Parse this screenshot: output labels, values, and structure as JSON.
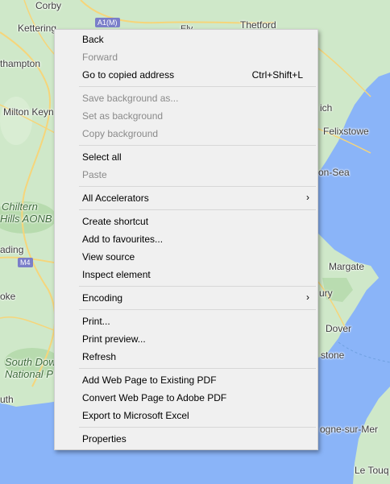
{
  "map": {
    "labels": {
      "corby": "Corby",
      "kettering": "Kettering",
      "a1m": "A1(M)",
      "ely": "Ely",
      "thetford": "Thetford",
      "hampton": "thampton",
      "milton_keynes": "Milton Keyn",
      "ich": "ich",
      "felixstowe": "Felixstowe",
      "on_sea": "on-Sea",
      "chiltern": "Chiltern",
      "hills_aonb": "Hills AONB",
      "ading": "ading",
      "m4": "M4",
      "margate": "Margate",
      "oke": "oke",
      "ury": "ury",
      "dover": "Dover",
      "stone": "stone",
      "south_downs": "South Dow",
      "national_p": "National P",
      "uth": "uth",
      "ogne": "ogne-sur-Mer",
      "le_touq": "Le Touq"
    },
    "colors": {
      "land": "#cfe8c9",
      "sea": "#8ab4f8",
      "road": "#f6d57a"
    }
  },
  "context_menu": {
    "items": [
      {
        "label": "Back",
        "disabled": false
      },
      {
        "label": "Forward",
        "disabled": true
      },
      {
        "label": "Go to copied address",
        "shortcut": "Ctrl+Shift+L",
        "disabled": false
      },
      {
        "label": "Save background as...",
        "disabled": true
      },
      {
        "label": "Set as background",
        "disabled": true
      },
      {
        "label": "Copy background",
        "disabled": true
      },
      {
        "label": "Select all",
        "disabled": false
      },
      {
        "label": "Paste",
        "disabled": true
      },
      {
        "label": "All Accelerators",
        "submenu": true,
        "disabled": false
      },
      {
        "label": "Create shortcut",
        "disabled": false
      },
      {
        "label": "Add to favourites...",
        "disabled": false
      },
      {
        "label": "View source",
        "disabled": false
      },
      {
        "label": "Inspect element",
        "disabled": false
      },
      {
        "label": "Encoding",
        "submenu": true,
        "disabled": false
      },
      {
        "label": "Print...",
        "disabled": false
      },
      {
        "label": "Print preview...",
        "disabled": false
      },
      {
        "label": "Refresh",
        "disabled": false
      },
      {
        "label": "Add Web Page to Existing PDF",
        "disabled": false
      },
      {
        "label": "Convert Web Page to Adobe PDF",
        "disabled": false
      },
      {
        "label": "Export to Microsoft Excel",
        "disabled": false
      },
      {
        "label": "Properties",
        "disabled": false
      }
    ],
    "submenu_arrow": "›"
  }
}
